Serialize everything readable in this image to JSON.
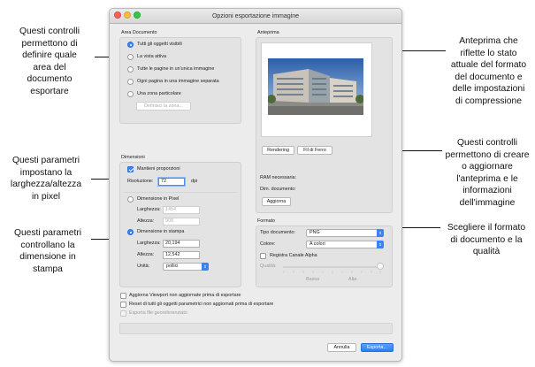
{
  "annotations": {
    "left": [
      {
        "lines": [
          "Questi controlli",
          "permettono di",
          "definire quale",
          "area del",
          "documento",
          "esportare"
        ]
      },
      {
        "lines": [
          "Questi parametri",
          "impostano la",
          "larghezza/altezza",
          "in pixel"
        ]
      },
      {
        "lines": [
          "Questi parametri",
          "controllano la",
          "dimensione in",
          "stampa"
        ]
      }
    ],
    "right": [
      {
        "lines": [
          "Anteprima che",
          "riflette lo stato",
          "attuale del formato",
          "del documento e",
          "delle impostazioni",
          "di compressione"
        ]
      },
      {
        "lines": [
          "Questi controlli",
          "permettono di creare",
          "o aggiornare",
          "l'anteprima e le",
          "informazioni",
          "dell'immagine"
        ]
      },
      {
        "lines": [
          "Scegliere il formato",
          "di documento e la",
          "qualità"
        ]
      }
    ]
  },
  "dialog": {
    "title": "Opzioni esportazione immagine",
    "colors": {
      "accent": "#3b82f6",
      "close": "#fc605b",
      "minimize": "#fdbc40",
      "zoom": "#34c84a"
    },
    "area": {
      "heading": "Area Documento",
      "options": [
        {
          "label": "Tutti gli oggetti visibili",
          "selected": true
        },
        {
          "label": "La vista attiva",
          "selected": false
        },
        {
          "label": "Tutte le pagine in un'unica immagine",
          "selected": false
        },
        {
          "label": "Ogni pagina in una immagine separata",
          "selected": false
        },
        {
          "label": "Una zona particolare",
          "selected": false
        }
      ],
      "define_zone_button": "Definisci la zona..."
    },
    "preview": {
      "heading": "Anteprima",
      "image_icon": "building-photo-icon",
      "rendering_button": "Rendering",
      "wireframe_button": "Fil di Ferro",
      "ram_label": "RAM necessaria:",
      "dim_label": "Dim. documento:",
      "update_button": "Aggiorna"
    },
    "dimensions": {
      "heading": "Dimensioni",
      "keep_proportions_label": "Mantieni proporzioni",
      "keep_proportions_checked": true,
      "resolution_label": "Risoluzione:",
      "resolution_value": "72",
      "resolution_unit": "dpi",
      "pixel_option": "Dimensione in Pixel",
      "pixel_width_label": "Larghezza:",
      "pixel_width_value": "1454",
      "pixel_height_label": "Altezza:",
      "pixel_height_value": "908",
      "print_option": "Dimensione in stampa",
      "print_width_label": "Larghezza:",
      "print_width_value": "20,194",
      "print_height_label": "Altezza:",
      "print_height_value": "12,542",
      "units_label": "Unità:",
      "units_value": "pollici"
    },
    "format": {
      "heading": "Formato",
      "doc_type_label": "Tipo documento:",
      "doc_type_value": "PNG",
      "color_label": "Colore:",
      "color_value": "A colori",
      "alpha_label": "Registra Canale Alpha",
      "quality_label": "Qualità:",
      "quality_low": "Bassa",
      "quality_high": "Alta"
    },
    "checks": [
      {
        "label": "Aggiorna Viewport non aggiornate prima di esportare",
        "enabled": true
      },
      {
        "label": "Reset di tutti gli oggetti parametrici non aggiornati prima di esportare",
        "enabled": true
      },
      {
        "label": "Esporta file georeferenziato",
        "enabled": false
      }
    ],
    "cancel_button": "Annulla",
    "export_button": "Esporta..."
  }
}
